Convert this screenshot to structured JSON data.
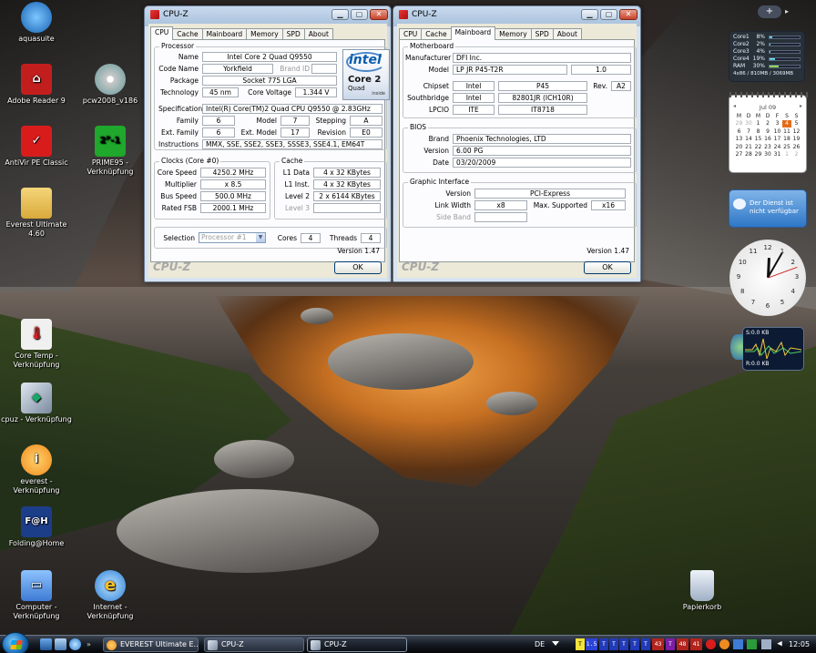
{
  "desktop": {
    "icons": [
      {
        "id": "aquasuite",
        "label": "aquasuite",
        "color": "#2b8ad9"
      },
      {
        "id": "adobe-reader",
        "label": "Adobe Reader 9",
        "color": "#c31e1e"
      },
      {
        "id": "pcw2008",
        "label": "pcw2008_v186",
        "color": "#c9c9c9"
      },
      {
        "id": "antivir",
        "label": "AntiVir PE Classic",
        "color": "#d81c1c"
      },
      {
        "id": "prime95",
        "label": "PRIME95 - Verknüpfung",
        "color": "#1fa82c"
      },
      {
        "id": "everest-folder",
        "label": "Everest Ultimate 4.60",
        "color": "#e8c04a"
      },
      {
        "id": "core-temp",
        "label": "Core Temp - Verknüpfung",
        "color": "#f0f0f0"
      },
      {
        "id": "cpuz",
        "label": "cpuz - Verknüpfung",
        "color": "#9aa7b8"
      },
      {
        "id": "everest",
        "label": "everest - Verknüpfung",
        "color": "#f08a1e"
      },
      {
        "id": "folding",
        "label": "Folding@Home",
        "color": "#1c3d88"
      },
      {
        "id": "computer",
        "label": "Computer - Verknüpfung",
        "color": "#3d7bd4"
      },
      {
        "id": "internet",
        "label": "Internet - Verknüpfung",
        "color": "#2b7fd6"
      },
      {
        "id": "papierkorb",
        "label": "Papierkorb",
        "color": "#b9c6d6"
      }
    ]
  },
  "cpuz_cpu": {
    "title": "CPU-Z",
    "tabs": [
      "CPU",
      "Cache",
      "Mainboard",
      "Memory",
      "SPD",
      "About"
    ],
    "active_tab": "CPU",
    "processor": {
      "group": "Processor",
      "name_label": "Name",
      "name": "Intel Core 2 Quad Q9550",
      "code_label": "Code Name",
      "code": "Yorkfield",
      "brand_id_label": "Brand ID",
      "package_label": "Package",
      "package": "Socket 775 LGA",
      "tech_label": "Technology",
      "tech": "45 nm",
      "voltage_label": "Core Voltage",
      "voltage": "1.344 V",
      "spec_label": "Specification",
      "spec": "Intel(R) Core(TM)2 Quad CPU    Q9550  @ 2.83GHz",
      "family_label": "Family",
      "family": "6",
      "model_label": "Model",
      "model": "7",
      "stepping_label": "Stepping",
      "stepping": "A",
      "ext_family_label": "Ext. Family",
      "ext_family": "6",
      "ext_model_label": "Ext. Model",
      "ext_model": "17",
      "revision_label": "Revision",
      "revision": "E0",
      "instr_label": "Instructions",
      "instr": "MMX, SSE, SSE2, SSE3, SSSE3, SSE4.1, EM64T"
    },
    "logo": {
      "brand": "intel",
      "line1": "Core 2",
      "line2": "Quad",
      "line3": "inside"
    },
    "clocks": {
      "group": "Clocks (Core #0)",
      "speed_label": "Core Speed",
      "speed": "4250.2 MHz",
      "mult_label": "Multiplier",
      "mult": "x 8.5",
      "bus_label": "Bus Speed",
      "bus": "500.0 MHz",
      "fsb_label": "Rated FSB",
      "fsb": "2000.1 MHz"
    },
    "cache": {
      "group": "Cache",
      "l1d_label": "L1 Data",
      "l1d": "4 x 32 KBytes",
      "l1i_label": "L1 Inst.",
      "l1i": "4 x 32 KBytes",
      "l2_label": "Level 2",
      "l2": "2 x 6144 KBytes",
      "l3_label": "Level 3",
      "l3": ""
    },
    "selection_label": "Selection",
    "selection": "Processor #1",
    "cores_label": "Cores",
    "cores": "4",
    "threads_label": "Threads",
    "threads": "4",
    "version": "Version 1.47",
    "brand": "CPU-Z",
    "ok": "OK"
  },
  "cpuz_mb": {
    "title": "CPU-Z",
    "tabs": [
      "CPU",
      "Cache",
      "Mainboard",
      "Memory",
      "SPD",
      "About"
    ],
    "active_tab": "Mainboard",
    "motherboard": {
      "group": "Motherboard",
      "manufacturer_label": "Manufacturer",
      "manufacturer": "DFI Inc.",
      "model_label": "Model",
      "model": "LP JR P45-T2R",
      "model_rev": "1.0",
      "chipset_label": "Chipset",
      "chipset_vendor": "Intel",
      "chipset": "P45",
      "rev_label": "Rev.",
      "rev": "A2",
      "south_label": "Southbridge",
      "south_vendor": "Intel",
      "south": "82801JR (ICH10R)",
      "lpcio_label": "LPCIO",
      "lpcio_vendor": "ITE",
      "lpcio": "IT8718"
    },
    "bios": {
      "group": "BIOS",
      "brand_label": "Brand",
      "brand": "Phoenix Technologies, LTD",
      "version_label": "Version",
      "version": "6.00 PG",
      "date_label": "Date",
      "date": "03/20/2009"
    },
    "graphic": {
      "group": "Graphic Interface",
      "version_label": "Version",
      "version": "PCI-Express",
      "width_label": "Link Width",
      "width": "x8",
      "max_label": "Max. Supported",
      "max": "x16",
      "side_label": "Side Band",
      "side": ""
    },
    "version": "Version 1.47",
    "brand": "CPU-Z",
    "ok": "OK"
  },
  "gadgets": {
    "cpu_meter": {
      "cores": [
        {
          "name": "Core1",
          "pct": "8%",
          "value": 8
        },
        {
          "name": "Core2",
          "pct": "2%",
          "value": 2
        },
        {
          "name": "Core3",
          "pct": "4%",
          "value": 4
        },
        {
          "name": "Core4",
          "pct": "19%",
          "value": 19
        }
      ],
      "ram": {
        "name": "RAM",
        "pct": "30%",
        "value": 30
      },
      "footer": "4x86 / 810MB / 3069MB"
    },
    "calendar": {
      "month": "Jul 09",
      "weekdays": [
        "M",
        "D",
        "M",
        "D",
        "F",
        "S",
        "S"
      ],
      "weeks": [
        [
          "29",
          "30",
          "1",
          "2",
          "3",
          "4",
          "5"
        ],
        [
          "6",
          "7",
          "8",
          "9",
          "10",
          "11",
          "12"
        ],
        [
          "13",
          "14",
          "15",
          "16",
          "17",
          "18",
          "19"
        ],
        [
          "20",
          "21",
          "22",
          "23",
          "24",
          "25",
          "26"
        ],
        [
          "27",
          "28",
          "29",
          "30",
          "31",
          "1",
          "2"
        ]
      ],
      "today": "4"
    },
    "weather": {
      "line1": "Der Dienst ist",
      "line2": "nicht verfügbar"
    },
    "clock": {
      "hour": 12,
      "minute": 5
    },
    "netmon": {
      "send": "S:0.0 KB",
      "recv": "R:0.0 KB"
    }
  },
  "taskbar": {
    "tasks": [
      {
        "label": "EVEREST Ultimate E...",
        "active": false
      },
      {
        "label": "CPU-Z",
        "active": false
      },
      {
        "label": "CPU-Z",
        "active": true
      }
    ],
    "lang": "DE",
    "tray": [
      "T",
      "1.5",
      "T",
      "T",
      "T",
      "T",
      "T",
      "43",
      "T",
      "48",
      "41"
    ],
    "time": "12:05"
  }
}
